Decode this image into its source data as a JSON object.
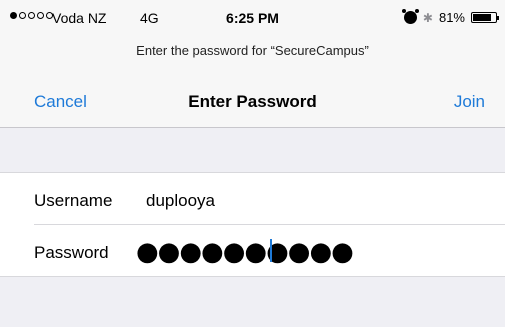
{
  "status": {
    "signal_dots_filled": 1,
    "signal_dots_total": 5,
    "carrier": "Voda NZ",
    "network": "4G",
    "time": "6:25 PM",
    "battery": "81%",
    "battery_level": 0.81
  },
  "prompt": "Enter the password for “SecureCampus”",
  "navbar": {
    "cancel_label": "Cancel",
    "title": "Enter Password",
    "join_label": "Join"
  },
  "form": {
    "username_label": "Username",
    "username_value": "duplooya",
    "password_label": "Password",
    "password_mask": "●●●●●●●●●●"
  },
  "colors": {
    "accent": "#1e7ad8",
    "background": "#efeff4"
  }
}
